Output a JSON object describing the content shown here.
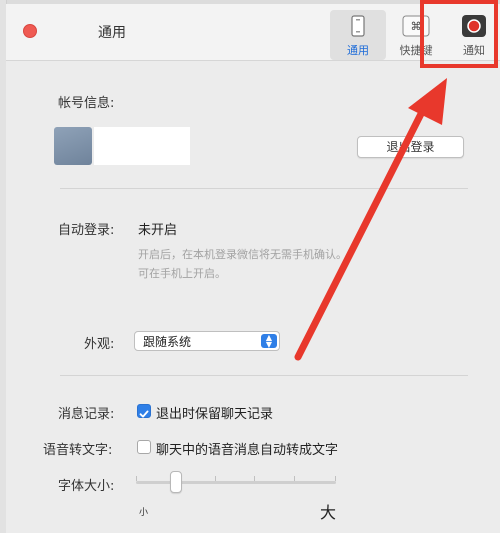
{
  "window": {
    "title": "通用"
  },
  "toolbar": {
    "items": [
      {
        "label": "通用",
        "icon": "phone-icon"
      },
      {
        "label": "快捷键",
        "icon": "command-key-icon"
      },
      {
        "label": "通知",
        "icon": "record-dot-icon"
      }
    ]
  },
  "account": {
    "label": "帐号信息:",
    "logout_button": "退出登录"
  },
  "auto_login": {
    "label": "自动登录:",
    "status": "未开启",
    "hint_line1": "开启后，在本机登录微信将无需手机确认。",
    "hint_line2": "可在手机上开启。"
  },
  "appearance": {
    "label": "外观:",
    "selected": "跟随系统"
  },
  "message_record": {
    "label": "消息记录:",
    "option": "退出时保留聊天记录",
    "checked": true
  },
  "voice_to_text": {
    "label": "语音转文字:",
    "option": "聊天中的语音消息自动转成文字",
    "checked": false
  },
  "font_size": {
    "label": "字体大小:",
    "min_label": "小",
    "max_label": "大",
    "level": 2,
    "levels": 7
  },
  "colors": {
    "accent": "#2f7fe7",
    "annotation": "#e8382c",
    "close": "#ef5a52"
  }
}
